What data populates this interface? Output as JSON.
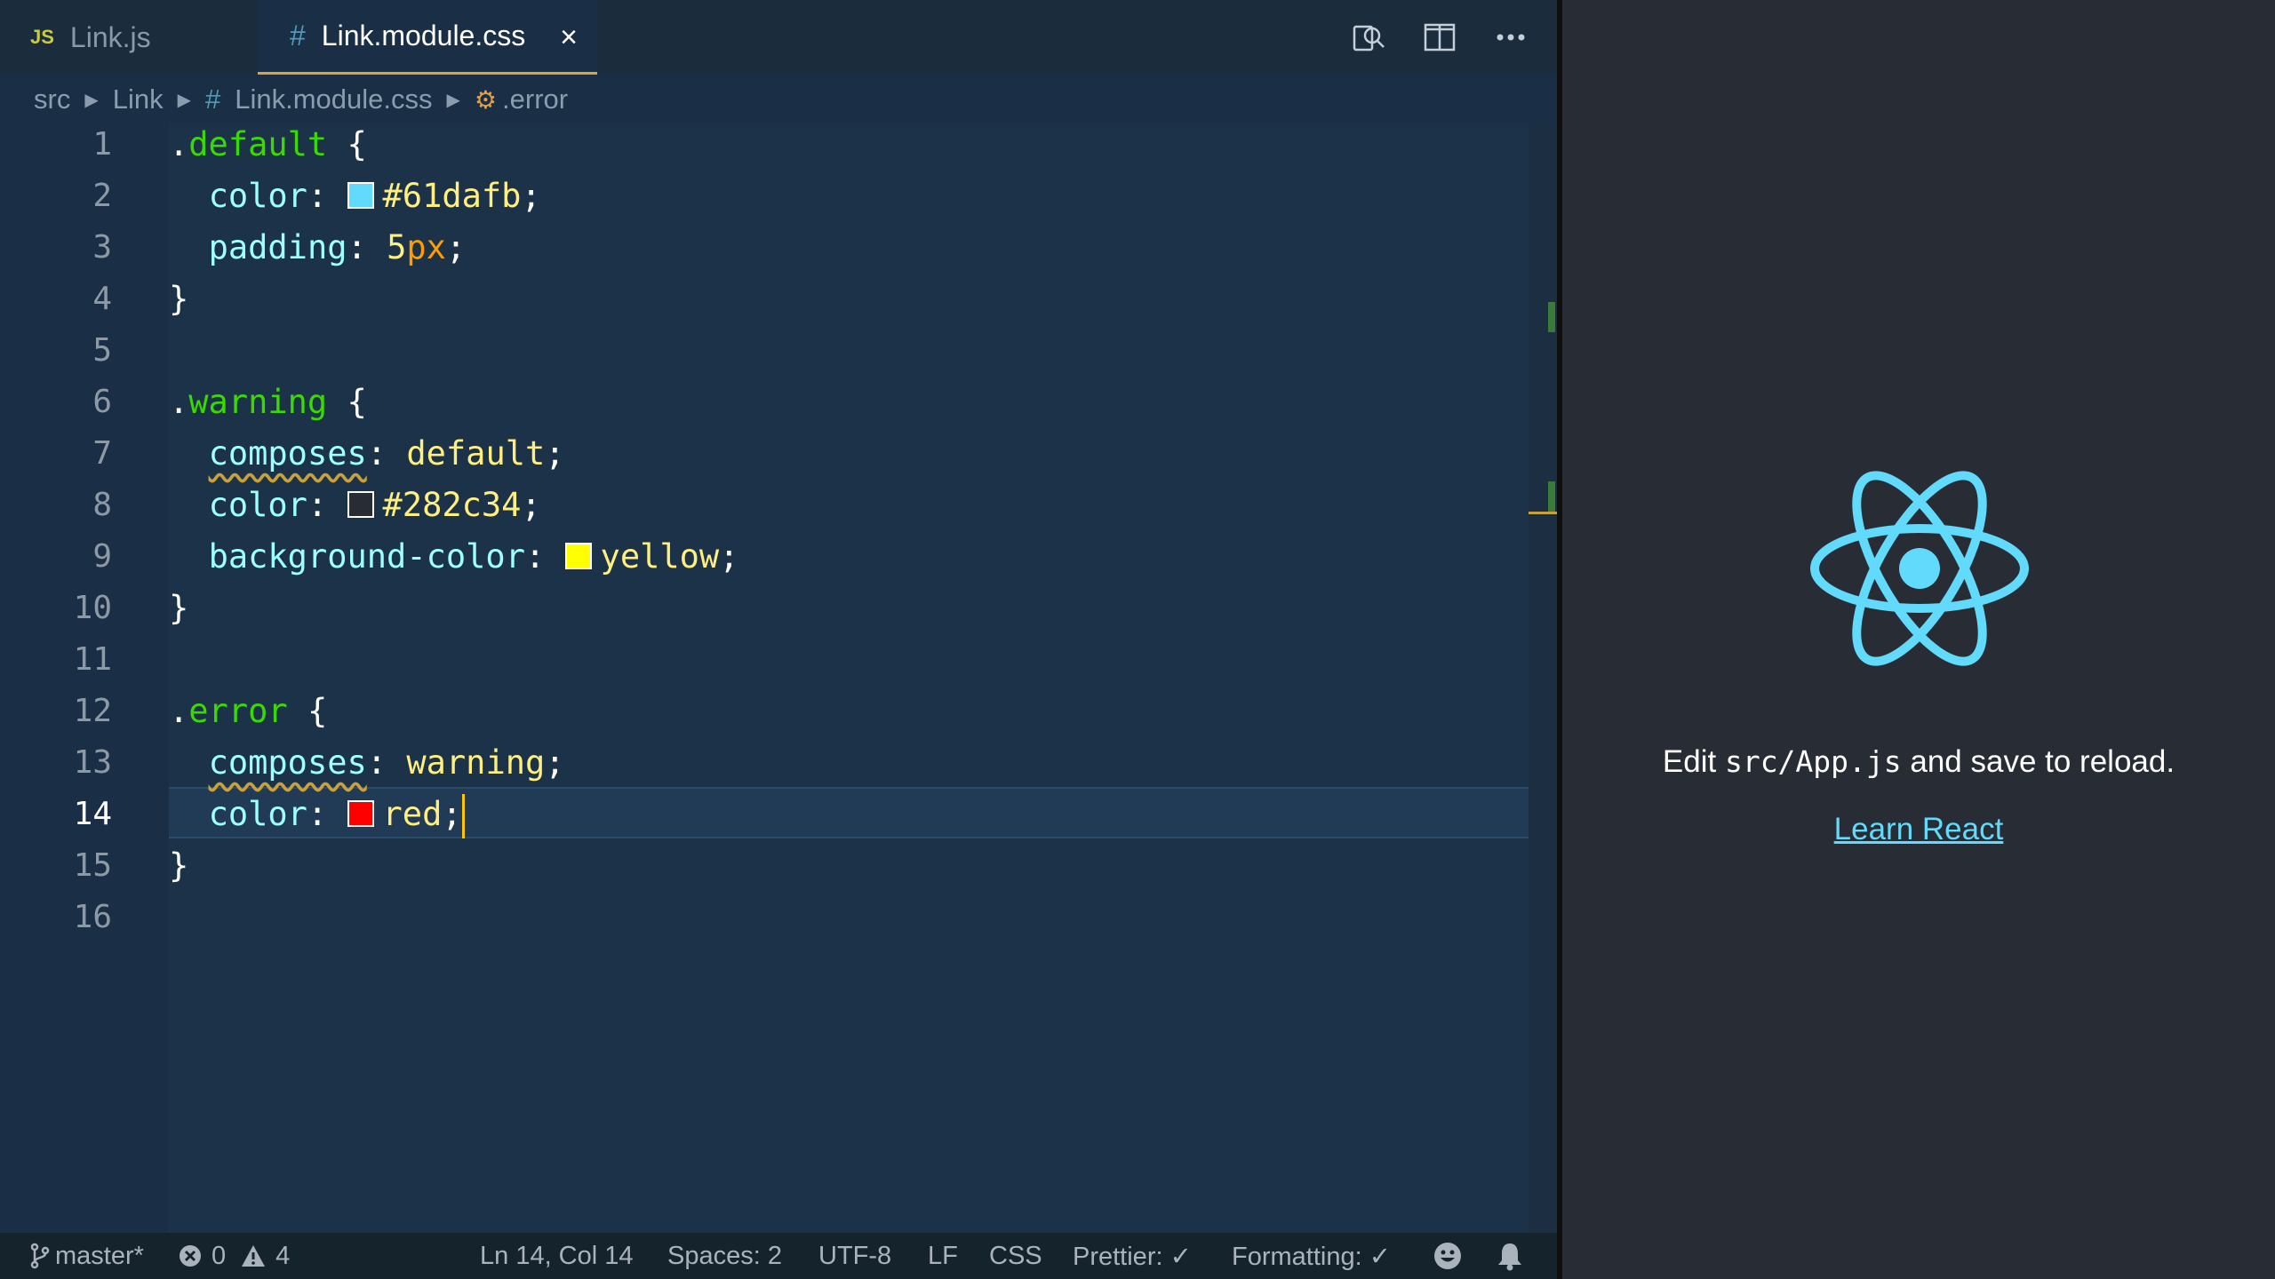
{
  "tabs": [
    {
      "badge": "JS",
      "label": "Link.js",
      "active": false
    },
    {
      "badge": "#",
      "label": "Link.module.css",
      "active": true,
      "close": "×"
    }
  ],
  "tab_actions": [
    "open-preview-icon",
    "split-editor-icon",
    "more-actions-icon"
  ],
  "breadcrumb": {
    "items": [
      "src",
      "Link",
      "Link.module.css",
      ".error"
    ]
  },
  "editor": {
    "line_numbers": [
      "1",
      "2",
      "3",
      "4",
      "5",
      "6",
      "7",
      "8",
      "9",
      "10",
      "11",
      "12",
      "13",
      "14",
      "15",
      "16"
    ],
    "current_line": 14
  },
  "status": {
    "branch": "master*",
    "errors": "0",
    "warnings": "4",
    "position": "Ln 14, Col 14",
    "spaces": "Spaces: 2",
    "encoding": "UTF-8",
    "eol": "LF",
    "language": "CSS",
    "prettier": "Prettier: ✓",
    "formatting": "Formatting: ✓"
  },
  "preview": {
    "edit_prefix": "Edit ",
    "edit_code": "src/App.js",
    "edit_suffix": " and save to reload.",
    "link": "Learn React",
    "accent": "#61dafb"
  },
  "colors": {
    "editor_bg": "#1a2f45",
    "selector": "#3ad900",
    "property": "#9effff",
    "value": "#ffee80",
    "number": "#ff9d00",
    "browser_bg": "#282c34"
  }
}
